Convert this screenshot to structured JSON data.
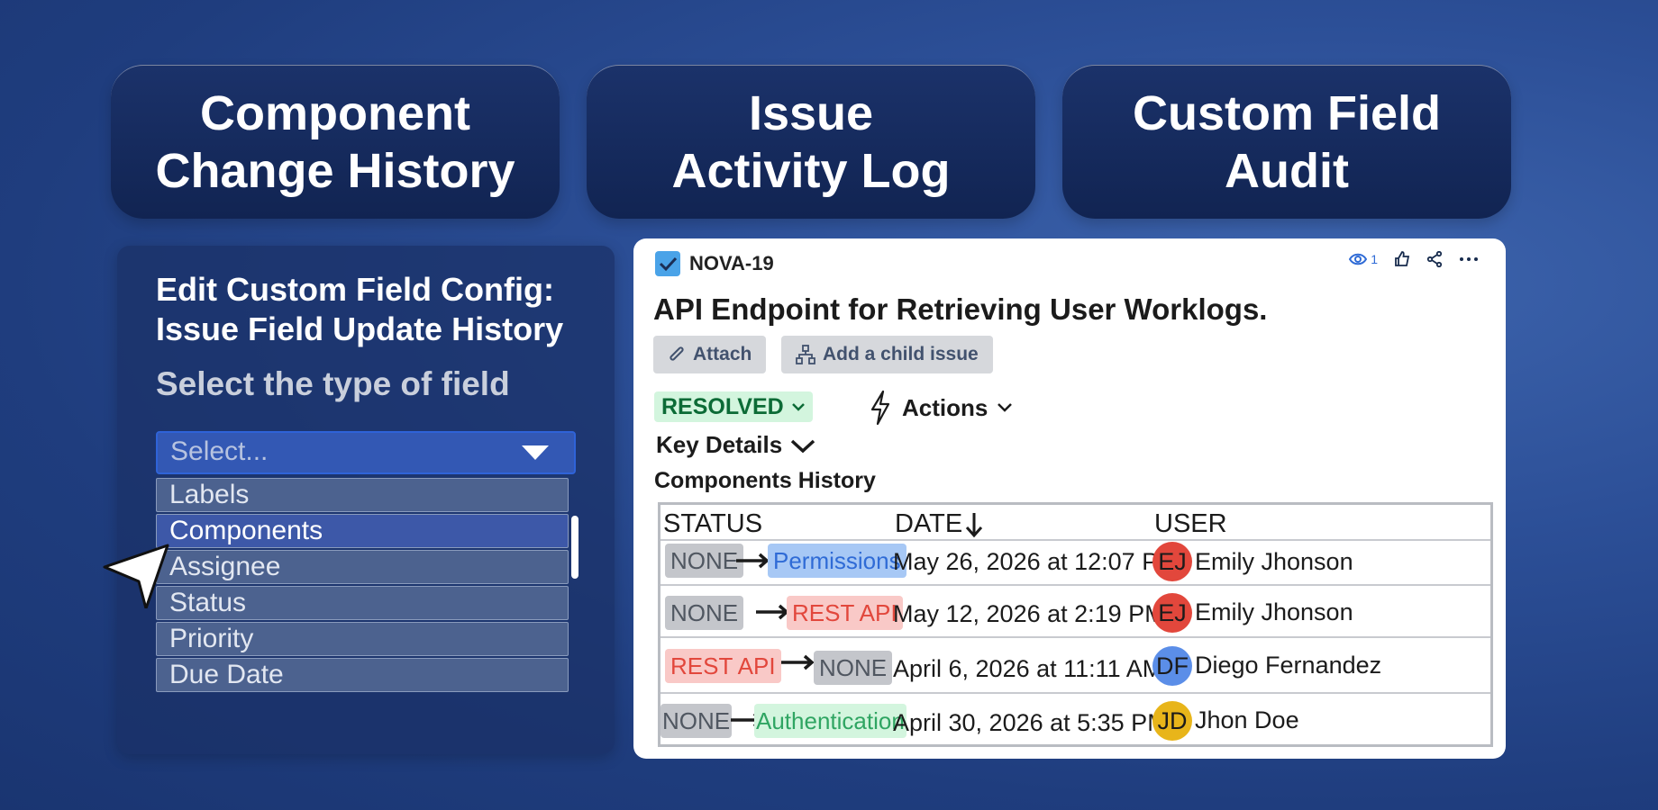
{
  "tiles": [
    {
      "label": "Component\nChange History"
    },
    {
      "label": "Issue\nActivity Log"
    },
    {
      "label": "Custom Field\nAudit"
    }
  ],
  "left_panel": {
    "title": "Edit Custom Field Config:\nIssue Field Update History",
    "subtitle": "Select the type of field",
    "select_placeholder": "Select...",
    "options": [
      "Labels",
      "Components",
      "Assignee",
      "Status",
      "Priority",
      "Due Date"
    ],
    "selected_option": "Components"
  },
  "card": {
    "issue_key": "NOVA-19",
    "watchers_count": "1",
    "summary": "API Endpoint for Retrieving User Worklogs.",
    "attach_label": "Attach",
    "add_child_label": "Add a child issue",
    "status": "RESOLVED",
    "actions_label": "Actions",
    "key_details_label": "Key Details",
    "components_history_label": "Components History",
    "columns": {
      "status": "STATUS",
      "date": "DATE",
      "user": "USER"
    },
    "rows": [
      {
        "from": "NONE",
        "to": "Permissions",
        "date": "May 26, 2026 at 12:07 PM",
        "initials": "EJ",
        "user": "Emily Jhonson"
      },
      {
        "from": "NONE",
        "to": "REST API",
        "date": "May 12, 2026 at 2:19 PM",
        "initials": "EJ",
        "user": "Emily Jhonson"
      },
      {
        "from": "REST API",
        "to": "NONE",
        "date": "April 6, 2026 at 11:11 AM",
        "initials": "DF",
        "user": "Diego Fernandez"
      },
      {
        "from": "NONE",
        "to": "Authentication",
        "date": "April 30, 2026 at 5:35 PM",
        "initials": "JD",
        "user": "Jhon Doe"
      }
    ]
  },
  "colors": {
    "background": "#2c4f97",
    "tile": "#132855",
    "accent_blue": "#2f6bd6",
    "resolved_green": "#0c6b36",
    "avatar_red": "#e2473c",
    "avatar_blue": "#5b8ee8",
    "avatar_yellow": "#e8b51a"
  },
  "icons": [
    "checkbox-icon",
    "eye-icon",
    "thumbs-up-icon",
    "share-icon",
    "more-icon",
    "paperclip-icon",
    "hierarchy-icon",
    "chevron-down-icon",
    "lightning-icon",
    "arrow-down-icon",
    "arrow-right-icon",
    "cursor-pointer-icon"
  ]
}
